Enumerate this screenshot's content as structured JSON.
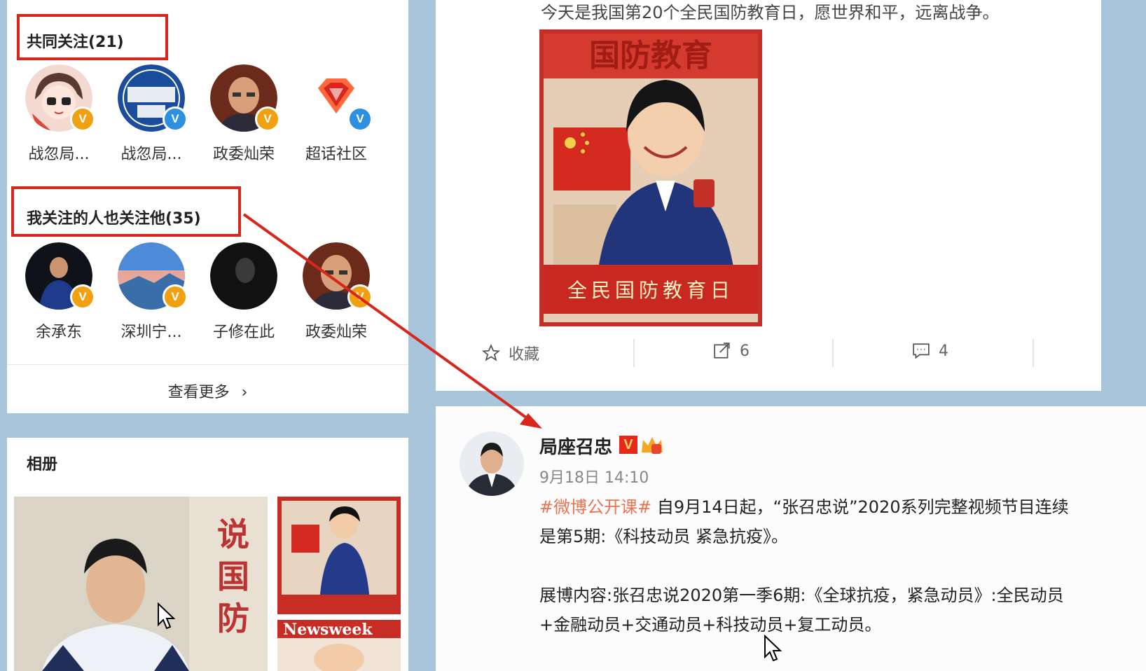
{
  "mutual": {
    "title": "共同关注(21)",
    "users": [
      {
        "name": "战忽局...",
        "badge": "V",
        "badge_color": "orange"
      },
      {
        "name": "战忽局...",
        "badge": "V",
        "badge_color": "blue"
      },
      {
        "name": "政委灿荣",
        "badge": "V",
        "badge_color": "orange"
      },
      {
        "name": "超话社区",
        "badge": "V",
        "badge_color": "blue"
      }
    ]
  },
  "followed_by_follows": {
    "title": "我关注的人也关注他(35)",
    "users": [
      {
        "name": "余承东",
        "badge": "V",
        "badge_color": "orange"
      },
      {
        "name": "深圳宁...",
        "badge": "V",
        "badge_color": "orange"
      },
      {
        "name": "子修在此",
        "badge": "",
        "badge_color": ""
      },
      {
        "name": "政委灿荣",
        "badge": "V",
        "badge_color": "orange"
      }
    ]
  },
  "see_more": {
    "label": "查看更多",
    "icon": "chevron-right-icon"
  },
  "album": {
    "title": "相册"
  },
  "prev_post": {
    "text": "今天是我国第20个全民国防教育日，愿世界和平，远离战争。",
    "poster_title": "国防教育",
    "poster_banner": "全民国防教育日",
    "actions": {
      "favorite_label": "收藏",
      "repost_count": "6",
      "comment_count": "4"
    }
  },
  "post": {
    "author": "局座召忠",
    "verified": "V",
    "time": "9月18日 14:10",
    "topic": "#微博公开课#",
    "line1": " 自9月14日起，“张召忠说”2020系列完整视频节目连续",
    "line2": "是第5期:《科技动员 紧急抗疫》。",
    "line3": "展博内容:张召忠说2020第一季6期:《全球抗疫，紧急动员》:全民动员",
    "line4": "+金融动员+交通动员+科技动员+复工动员。"
  },
  "colors": {
    "highlight_red": "#d8261c",
    "topic_orange": "#eb7350",
    "badge_orange": "#f0a010",
    "badge_blue": "#2d8fe0",
    "page_bg": "#a9c5dc"
  }
}
